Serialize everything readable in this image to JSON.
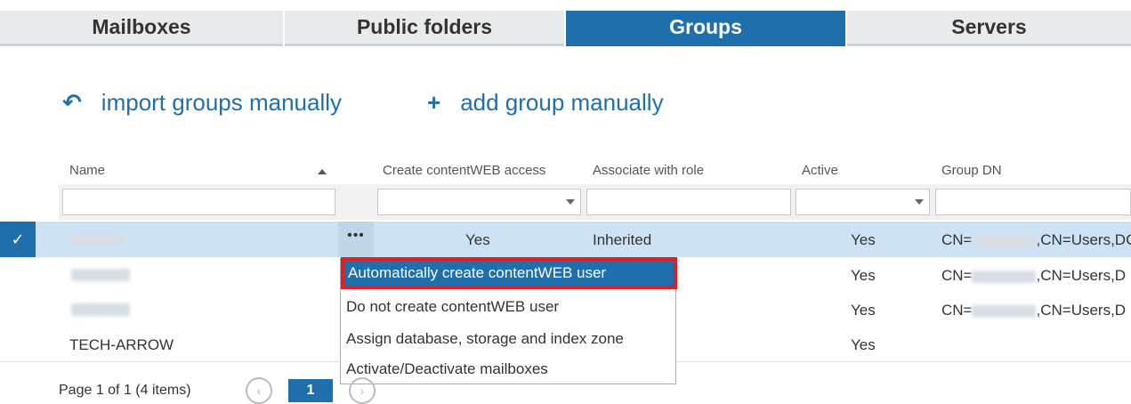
{
  "tabs": [
    {
      "label": "Mailboxes",
      "active": false
    },
    {
      "label": "Public folders",
      "active": false
    },
    {
      "label": "Groups",
      "active": true
    },
    {
      "label": "Servers",
      "active": false
    }
  ],
  "actions": {
    "import": {
      "icon": "undo-arrow-icon",
      "label": "import groups manually"
    },
    "add": {
      "icon": "plus-icon",
      "label": "add group manually"
    }
  },
  "grid": {
    "columns": [
      "Name",
      "Create contentWEB access",
      "Associate with role",
      "Active",
      "Group DN"
    ],
    "sort_icon": "sort-ascending-icon",
    "rows": [
      {
        "name": "",
        "create_access": "Yes",
        "role": "Inherited",
        "active": "Yes",
        "dn_prefix": "CN=",
        "dn_suffix": ",CN=Users,DC",
        "selected": true
      },
      {
        "name": "",
        "create_access": "",
        "role": "",
        "active": "Yes",
        "dn_prefix": "CN=",
        "dn_suffix": ",CN=Users,D",
        "selected": false
      },
      {
        "name": "",
        "create_access": "",
        "role": "",
        "active": "Yes",
        "dn_prefix": "CN=",
        "dn_suffix": ",CN=Users,D",
        "selected": false
      },
      {
        "name": "TECH-ARROW",
        "create_access": "",
        "role": "",
        "active": "Yes",
        "dn_prefix": "",
        "dn_suffix": "",
        "selected": false
      }
    ],
    "row_menu_glyph": "•••",
    "check_glyph": "✓"
  },
  "context_menu": {
    "items": [
      "Automatically create contentWEB user",
      "Do not create contentWEB user",
      "Assign database, storage and index zone",
      "Activate/Deactivate mailboxes"
    ],
    "highlighted_index": 0
  },
  "pager": {
    "summary": "Page 1 of 1 (4 items)",
    "current_page": "1",
    "prev_glyph": "‹",
    "next_glyph": "›"
  },
  "colors": {
    "accent": "#1f6fad",
    "highlight_border": "#e41d24",
    "selected_row": "#cde3f5"
  }
}
